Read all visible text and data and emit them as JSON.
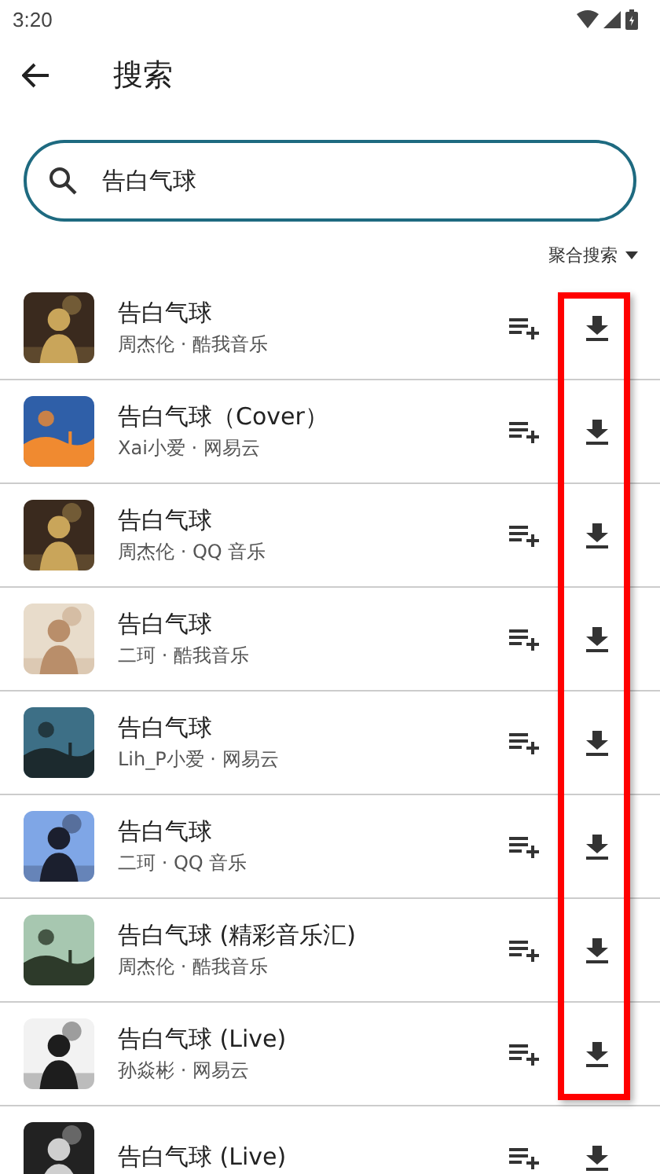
{
  "status_bar": {
    "time": "3:20"
  },
  "top_bar": {
    "title": "搜索"
  },
  "search": {
    "value": "告白气球"
  },
  "source_filter": {
    "label": "聚合搜索"
  },
  "download_highlighted": true,
  "results": [
    {
      "title": "告白气球",
      "subtitle": "周杰伦 · 酷我音乐"
    },
    {
      "title": "告白气球（Cover）",
      "subtitle": "Xai小爱 · 网易云"
    },
    {
      "title": "告白气球",
      "subtitle": "周杰伦 · QQ 音乐"
    },
    {
      "title": "告白气球",
      "subtitle": "二珂 · 酷我音乐"
    },
    {
      "title": "告白气球",
      "subtitle": "Lih_P小爱 · 网易云"
    },
    {
      "title": "告白气球",
      "subtitle": "二珂 · QQ 音乐"
    },
    {
      "title": "告白气球 (精彩音乐汇)",
      "subtitle": "周杰伦 · 酷我音乐"
    },
    {
      "title": "告白气球 (Live)",
      "subtitle": "孙焱彬 · 网易云"
    },
    {
      "title": "告白气球 (Live)"
    }
  ]
}
